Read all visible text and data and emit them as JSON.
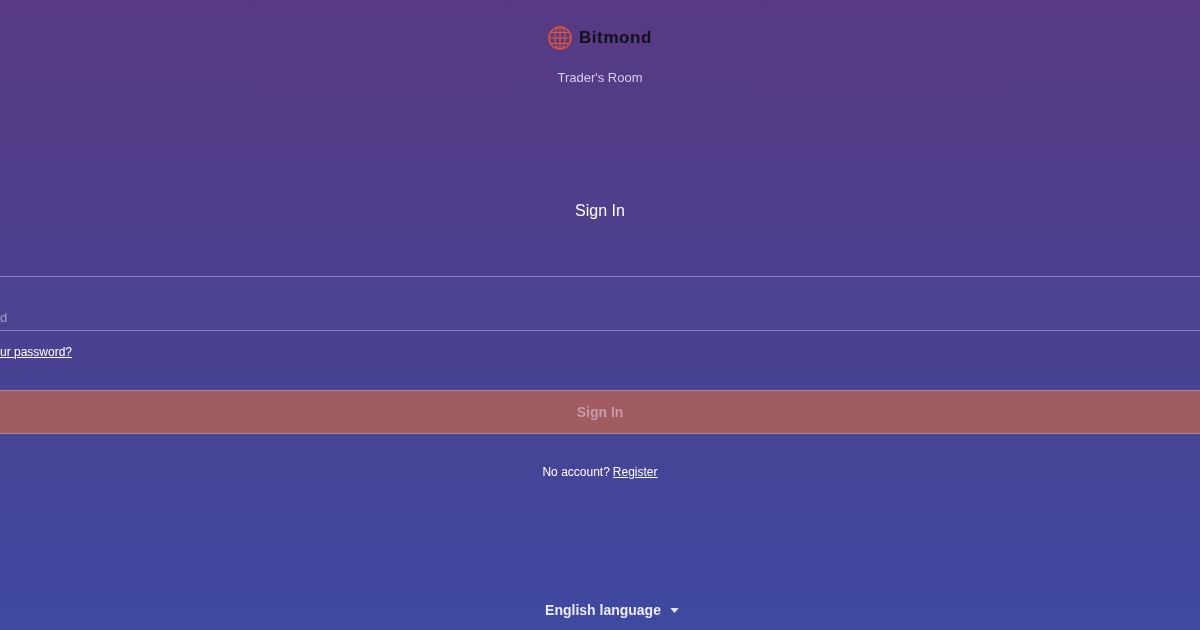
{
  "header": {
    "brand": "Bitmond",
    "subtitle": "Trader's Room"
  },
  "form": {
    "title": "Sign In",
    "password_field": {
      "placeholder": "d"
    },
    "forgot_link": "ur password?",
    "submit": {
      "label": "Sign In",
      "disabled": true
    },
    "register_prompt": "No account?",
    "register_link": "Register"
  },
  "language": {
    "label": "English language"
  }
}
